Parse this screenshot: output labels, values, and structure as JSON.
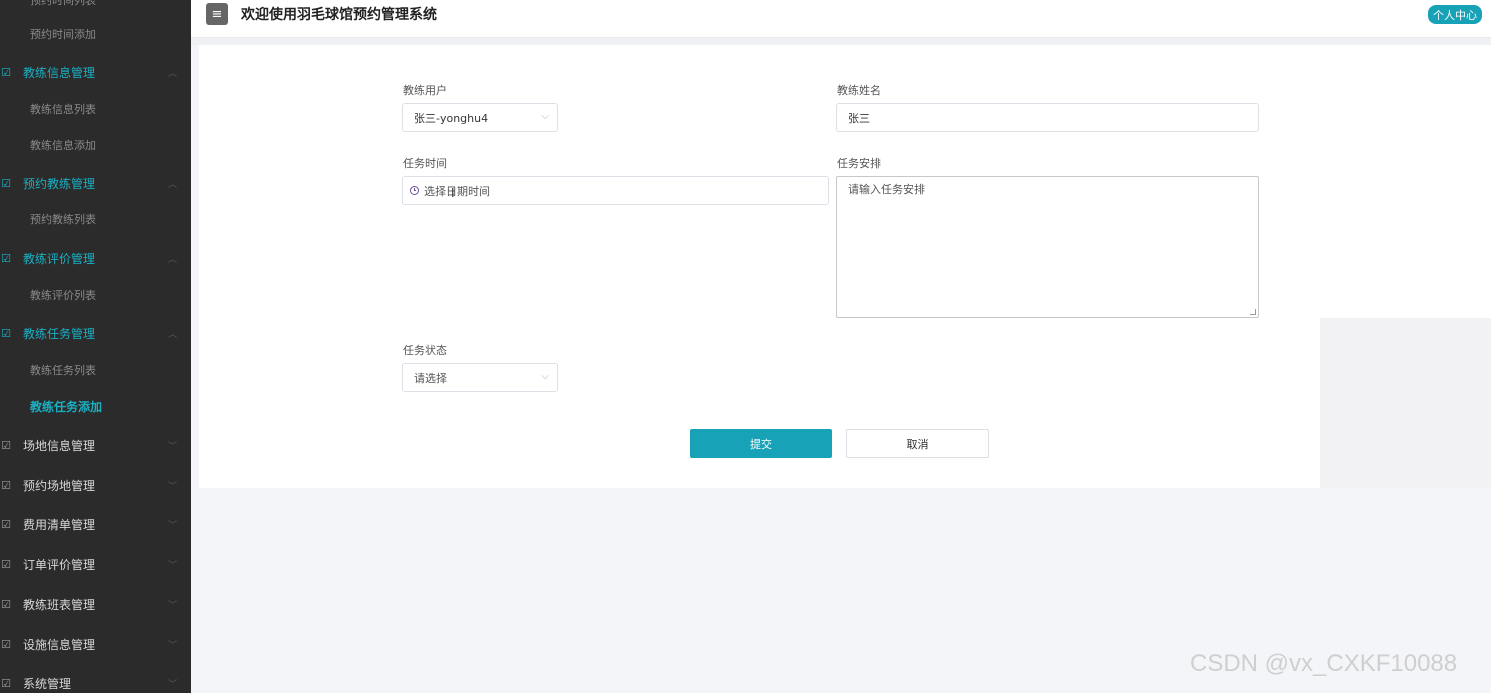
{
  "sidebar": {
    "items": [
      {
        "type": "sub",
        "label": "预约时间列表"
      },
      {
        "type": "sub",
        "label": "预约时间添加"
      },
      {
        "type": "group",
        "label": "教练信息管理",
        "open": true
      },
      {
        "type": "sub",
        "label": "教练信息列表"
      },
      {
        "type": "sub",
        "label": "教练信息添加"
      },
      {
        "type": "group",
        "label": "预约教练管理",
        "open": true
      },
      {
        "type": "sub",
        "label": "预约教练列表"
      },
      {
        "type": "group",
        "label": "教练评价管理",
        "open": true
      },
      {
        "type": "sub",
        "label": "教练评价列表"
      },
      {
        "type": "group",
        "label": "教练任务管理",
        "open": true
      },
      {
        "type": "sub",
        "label": "教练任务列表"
      },
      {
        "type": "sub",
        "label": "教练任务添加",
        "active": true
      },
      {
        "type": "group",
        "label": "场地信息管理"
      },
      {
        "type": "group",
        "label": "预约场地管理"
      },
      {
        "type": "group",
        "label": "费用清单管理"
      },
      {
        "type": "group",
        "label": "订单评价管理"
      },
      {
        "type": "group",
        "label": "教练班表管理"
      },
      {
        "type": "group",
        "label": "设施信息管理"
      },
      {
        "type": "group",
        "label": "系统管理"
      }
    ]
  },
  "header": {
    "menu_icon": "hamburger-icon",
    "title": "欢迎使用羽毛球馆预约管理系统",
    "profile_label": "个人中心"
  },
  "form": {
    "coach_user": {
      "label": "教练用户",
      "value": "张三-yonghu4"
    },
    "coach_name": {
      "label": "教练姓名",
      "value": "张三"
    },
    "task_time": {
      "label": "任务时间",
      "placeholder": "选择日期时间"
    },
    "task_plan": {
      "label": "任务安排",
      "placeholder": "请输入任务安排"
    },
    "task_status": {
      "label": "任务状态",
      "placeholder": "请选择"
    },
    "submit_label": "提交",
    "cancel_label": "取消"
  },
  "colors": {
    "accent": "#17a2b8",
    "sidebar_bg": "#2b2b2b"
  },
  "watermark": "CSDN @vx_CXKF10088"
}
